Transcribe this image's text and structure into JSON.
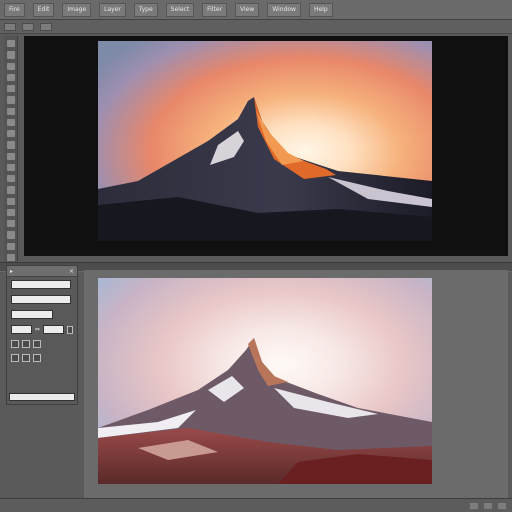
{
  "menubar": {
    "items": [
      "Fire",
      "Edit",
      "Image",
      "Layer",
      "Type",
      "Select",
      "Filter",
      "View",
      "Window",
      "Help"
    ]
  },
  "panel": {
    "header_label": "▸",
    "field_1": "",
    "field_2": "",
    "field_3": "",
    "value_1": "",
    "value_2": "",
    "footer_field": ""
  },
  "icons": {
    "close": "close-icon",
    "link": "link-icon",
    "tool": "tool-icon"
  },
  "colors": {
    "dark_canvas": "#101010",
    "panel_bg": "#595959",
    "workspace_bg": "#5a5a5a"
  }
}
